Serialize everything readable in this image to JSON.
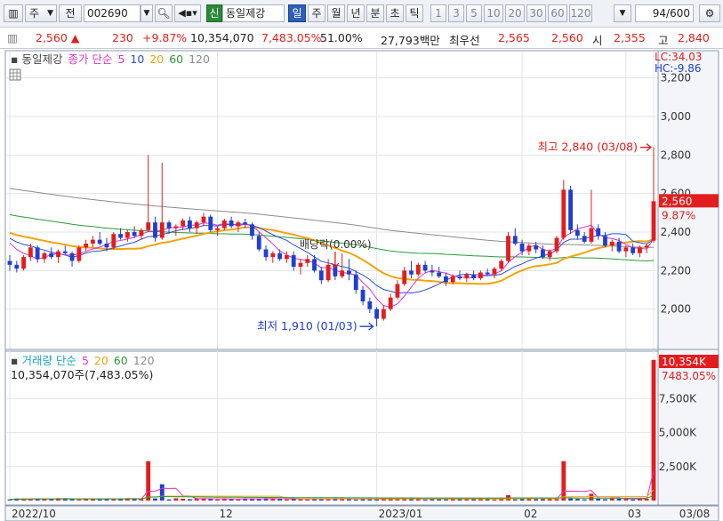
{
  "toolbar": {
    "period_selector": "주",
    "market_selector": "전",
    "code": "002690",
    "badge": "신",
    "stock_name": "동일제강",
    "period_tabs": [
      "일",
      "주",
      "월",
      "년",
      "분",
      "초",
      "틱"
    ],
    "active_period": "일",
    "interval_buttons": [
      "1",
      "3",
      "5",
      "10",
      "20",
      "30",
      "60",
      "120"
    ],
    "count": "94",
    "count_total": "/600"
  },
  "quote": {
    "price": "2,560",
    "arrow": "▲",
    "change": "230",
    "change_pct": "+9.87%",
    "volume": "10,354,070",
    "volume_ratio": "7,483.05%",
    "rate": "51.00%",
    "trade_value": "27,793백만",
    "ask_label": "최우선",
    "ask": "2,565",
    "bid": "2,560",
    "open_label": "시",
    "open": "2,355",
    "high_label": "고",
    "high": "2,840"
  },
  "colors": {
    "up": "#e31d1d",
    "down": "#1f3fd0",
    "ma5": "#e033c8",
    "ma10": "#2c4fd6",
    "ma20": "#f1a40e",
    "ma60": "#2a9a3a",
    "ma120": "#8c8c8c",
    "vol_ma5": "#e033c8",
    "vol_ma20": "#f1a40e",
    "vol_ma60": "#2a9a3a"
  },
  "chart_data": {
    "type": "candlestick",
    "price_panel": {
      "title": "동일제강",
      "legend_label": "종가 단순",
      "ma_periods": [
        "5",
        "10",
        "20",
        "60",
        "120"
      ],
      "ylim": [
        1800,
        3300
      ],
      "yticks": [
        2000,
        2200,
        2400,
        2600,
        2800,
        3000,
        3200
      ],
      "ytick_labels": [
        "2,000",
        "2,200",
        "2,400",
        "2,600",
        "2,800",
        "3,000",
        "3,200"
      ],
      "lc_label": "LC:34.03",
      "hc_label": "HC:-9.86",
      "last_price_label": "2,560",
      "last_change_label": "9.87%",
      "last_price": 2560,
      "high_annotation": "최고 2,840 (03/08)",
      "high_value": 2840,
      "low_annotation": "최저 1,910 (01/03)",
      "low_value": 1910,
      "dividend_annotation": "배당락(0.00%)",
      "candles": [
        [
          2250,
          2280,
          2200,
          2230
        ],
        [
          2230,
          2250,
          2190,
          2210
        ],
        [
          2210,
          2280,
          2200,
          2270
        ],
        [
          2270,
          2340,
          2250,
          2320
        ],
        [
          2320,
          2330,
          2240,
          2260
        ],
        [
          2260,
          2300,
          2240,
          2290
        ],
        [
          2290,
          2320,
          2260,
          2270
        ],
        [
          2270,
          2310,
          2240,
          2300
        ],
        [
          2300,
          2330,
          2280,
          2290
        ],
        [
          2290,
          2300,
          2220,
          2250
        ],
        [
          2250,
          2330,
          2240,
          2320
        ],
        [
          2320,
          2360,
          2300,
          2340
        ],
        [
          2340,
          2380,
          2320,
          2360
        ],
        [
          2360,
          2400,
          2330,
          2340
        ],
        [
          2340,
          2370,
          2300,
          2320
        ],
        [
          2320,
          2400,
          2310,
          2390
        ],
        [
          2390,
          2420,
          2360,
          2370
        ],
        [
          2370,
          2410,
          2350,
          2400
        ],
        [
          2400,
          2430,
          2370,
          2380
        ],
        [
          2380,
          2420,
          2360,
          2410
        ],
        [
          2410,
          2800,
          2400,
          2450
        ],
        [
          2450,
          2480,
          2350,
          2370
        ],
        [
          2370,
          2760,
          2360,
          2450
        ],
        [
          2450,
          2460,
          2390,
          2420
        ],
        [
          2420,
          2440,
          2380,
          2430
        ],
        [
          2430,
          2470,
          2410,
          2460
        ],
        [
          2460,
          2480,
          2400,
          2420
        ],
        [
          2420,
          2460,
          2390,
          2450
        ],
        [
          2450,
          2500,
          2430,
          2480
        ],
        [
          2480,
          2490,
          2400,
          2410
        ],
        [
          2410,
          2430,
          2380,
          2420
        ],
        [
          2420,
          2470,
          2410,
          2460
        ],
        [
          2460,
          2480,
          2420,
          2430
        ],
        [
          2430,
          2460,
          2400,
          2450
        ],
        [
          2450,
          2470,
          2420,
          2440
        ],
        [
          2440,
          2450,
          2360,
          2380
        ],
        [
          2380,
          2400,
          2300,
          2310
        ],
        [
          2310,
          2330,
          2250,
          2270
        ],
        [
          2270,
          2300,
          2240,
          2290
        ],
        [
          2290,
          2310,
          2250,
          2260
        ],
        [
          2260,
          2300,
          2240,
          2280
        ],
        [
          2280,
          2300,
          2200,
          2220
        ],
        [
          2220,
          2260,
          2180,
          2240
        ],
        [
          2240,
          2280,
          2220,
          2260
        ],
        [
          2260,
          2280,
          2190,
          2200
        ],
        [
          2200,
          2220,
          2130,
          2150
        ],
        [
          2150,
          2260,
          2140,
          2230
        ],
        [
          2230,
          2250,
          2150,
          2170
        ],
        [
          2170,
          2290,
          2160,
          2200
        ],
        [
          2200,
          2260,
          2150,
          2180
        ],
        [
          2180,
          2200,
          2080,
          2100
        ],
        [
          2100,
          2120,
          2020,
          2040
        ],
        [
          2040,
          2060,
          1980,
          2000
        ],
        [
          2000,
          2010,
          1910,
          1950
        ],
        [
          1950,
          2020,
          1940,
          2000
        ],
        [
          2000,
          2080,
          1990,
          2060
        ],
        [
          2060,
          2150,
          2050,
          2130
        ],
        [
          2130,
          2220,
          2120,
          2200
        ],
        [
          2200,
          2250,
          2160,
          2180
        ],
        [
          2180,
          2240,
          2170,
          2230
        ],
        [
          2230,
          2250,
          2190,
          2200
        ],
        [
          2200,
          2230,
          2170,
          2190
        ],
        [
          2190,
          2220,
          2160,
          2170
        ],
        [
          2170,
          2190,
          2120,
          2140
        ],
        [
          2140,
          2180,
          2130,
          2170
        ],
        [
          2170,
          2200,
          2150,
          2160
        ],
        [
          2160,
          2190,
          2140,
          2180
        ],
        [
          2180,
          2200,
          2150,
          2160
        ],
        [
          2160,
          2200,
          2150,
          2190
        ],
        [
          2190,
          2210,
          2170,
          2180
        ],
        [
          2180,
          2220,
          2160,
          2210
        ],
        [
          2210,
          2260,
          2200,
          2250
        ],
        [
          2250,
          2400,
          2240,
          2380
        ],
        [
          2380,
          2420,
          2330,
          2340
        ],
        [
          2340,
          2360,
          2280,
          2300
        ],
        [
          2300,
          2340,
          2280,
          2330
        ],
        [
          2330,
          2350,
          2290,
          2310
        ],
        [
          2310,
          2330,
          2260,
          2270
        ],
        [
          2270,
          2310,
          2250,
          2300
        ],
        [
          2300,
          2380,
          2290,
          2370
        ],
        [
          2370,
          2670,
          2360,
          2620
        ],
        [
          2620,
          2640,
          2390,
          2410
        ],
        [
          2410,
          2440,
          2360,
          2380
        ],
        [
          2380,
          2400,
          2340,
          2350
        ],
        [
          2350,
          2620,
          2340,
          2420
        ],
        [
          2420,
          2440,
          2360,
          2380
        ],
        [
          2380,
          2400,
          2320,
          2330
        ],
        [
          2330,
          2360,
          2300,
          2350
        ],
        [
          2350,
          2370,
          2290,
          2300
        ],
        [
          2300,
          2330,
          2270,
          2320
        ],
        [
          2320,
          2340,
          2280,
          2290
        ],
        [
          2290,
          2330,
          2270,
          2320
        ],
        [
          2320,
          2340,
          2290,
          2330
        ],
        [
          2355,
          2840,
          2345,
          2560
        ]
      ]
    },
    "volume_panel": {
      "legend_label": "거래량 단순",
      "ma_periods": [
        "5",
        "20",
        "60",
        "120"
      ],
      "volume_label": "10,354,070주(7,483.05%)",
      "ylim": [
        0,
        10800000
      ],
      "yticks": [
        2500000,
        5000000,
        7500000
      ],
      "ytick_labels": [
        "2,500K",
        "5,000K",
        "7,500K"
      ],
      "last_volume_label": "10,354K",
      "last_ratio_label": "7483.05%",
      "spikes": [
        {
          "index": 20,
          "value": 2900000,
          "up": true
        },
        {
          "index": 22,
          "value": 1200000,
          "up": false
        },
        {
          "index": 72,
          "value": 400000,
          "up": true
        },
        {
          "index": 80,
          "value": 2900000,
          "up": true
        },
        {
          "index": 84,
          "value": 500000,
          "up": true
        },
        {
          "index": 93,
          "value": 10354070,
          "up": true
        }
      ],
      "base_value": 130000
    },
    "x_labels": [
      {
        "index": 0,
        "label": "2022/10"
      },
      {
        "index": 30,
        "label": "12"
      },
      {
        "index": 53,
        "label": "2023/01"
      },
      {
        "index": 74,
        "label": "02"
      },
      {
        "index": 89,
        "label": "03"
      },
      {
        "index": 93,
        "label": "03/08"
      }
    ]
  }
}
